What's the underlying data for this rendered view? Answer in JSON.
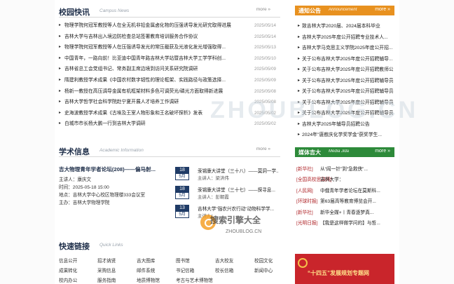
{
  "news": {
    "title": "校园快讯",
    "subtitle": "Campus News",
    "more": "more »",
    "items": [
      {
        "t": "物理学院何冠军教授等人在全无机非铅金属卤化物的压强诱导发光研究取得进展",
        "d": "2025/05/14"
      },
      {
        "t": "吉林大学与吉林出入境边防检查总站签署教育培训服务合作协议",
        "d": "2025/05/14"
      },
      {
        "t": "物理学院何冠军教授等人在压强诱导发光的常压截获及光液化发光增强取得...",
        "d": "2025/05/13"
      },
      {
        "t": "中国青年，一路向前！比亚迪中国青年路吉林大学站暨吉林大学工学学科创...",
        "d": "2025/05/10"
      },
      {
        "t": "吉林省总工会党组书记、常务副主席边境到访问关系研究院调研",
        "d": "2025/05/09"
      },
      {
        "t": "隋建利教授学术成果《中国农村数字韧性的理论框架、实践路径与政策选择...",
        "d": "2025/05/09"
      },
      {
        "t": "杨新一教授在高压调导金属有机框架材料多色可调荧光/磷光方面取得新进展",
        "d": "2025/05/08"
      },
      {
        "t": "吉林大学哲学社会科学院赴宁夏开展人才培养工作调研",
        "d": "2025/05/08"
      },
      {
        "t": "史海波教授学术成果《古埃及王室人物形象和王名破坏探析》发表",
        "d": "2025/05/02"
      },
      {
        "t": "白城市市长杨大鹏一行到吉林大学调研",
        "d": "2025/05/02"
      }
    ]
  },
  "notice": {
    "title": "通知公告",
    "subtitle": "Announcement",
    "more": "more »",
    "items": [
      "致吉林大学2020届、2024届本科毕业",
      "吉林大学2025年度公开招聘专业技术人...",
      "吉林大学马克思主义学院2025年度公开招...",
      "关于公布吉林大学2025年度公开招聘辅导...",
      "关于公布吉林大学2025年度公开招聘教师公告（...",
      "关于公布吉林大学2025年度公开招聘辅导员招聘进...",
      "关于公布吉林大学2025年度公开招聘辅导员招聘进...",
      "关于公布吉林大学2025年度公开招聘辅导员招聘进...",
      "关于公布吉林大学2025年度公开招聘辅导员招聘进...",
      "吉林大学2025年辅导员招聘公告",
      "2024年\"唐敖庆化学奖学金\"获奖学生..."
    ]
  },
  "academic": {
    "title": "学术信息",
    "subtitle": "Academic Information",
    "more": "more »",
    "feature": {
      "title": "吉大物理青年学者论坛(208)——偏马射...",
      "speaker": "主讲人：康庆文",
      "time": "时间：2025-05-18 15:00",
      "place": "地点：吉林大学中心校区物理楼333会议室",
      "host": "主办：吉林大学物理学院"
    },
    "items": [
      {
        "day": "18",
        "mon": "5月",
        "t": "汞锡康大讲堂（三十八）——莫洞一学...",
        "s": "主讲人：梁洪伟"
      },
      {
        "day": "18",
        "mon": "5月",
        "t": "汞锡康大讲堂（三十七）——探寻息...",
        "s": "主讲人：彭朝霞"
      },
      {
        "day": "13",
        "mon": "5月",
        "t": "吉林大学\"强农兴农行动\"动物科学学...",
        "s": "主讲人：..."
      }
    ]
  },
  "media": {
    "title": "媒体吉大",
    "subtitle": "Media Jlda",
    "more": "more »",
    "items": [
      {
        "src": "[新华社]",
        "t": "从“阎一针”到“急救侠”..."
      },
      {
        "src": "[全国高校思政网]",
        "t": "吉林大学："
      },
      {
        "src": "[人民网]",
        "t": "中俄青年学者论坛在莫斯科..."
      },
      {
        "src": "[环球时报]",
        "t": "第63届高等教育博览会开..."
      },
      {
        "src": "[新华社]",
        "t": "新华全媒+丨青春逐梦真..."
      },
      {
        "src": "[光明日报]",
        "t": "【我是这样做学问的】与哲..."
      }
    ]
  },
  "links": {
    "title": "快速链接",
    "subtitle": "Quick Links",
    "items": [
      [
        "信息公开",
        "招才纳贤",
        "吉大图库",
        "图书馆",
        "吉大校友",
        "校园文化"
      ],
      [
        "成果转化",
        "采购信息",
        "邮件系统",
        "书记信箱",
        "校长信箱",
        "新闻中心"
      ],
      [
        "校内办公",
        "服务指南",
        "地质博物馆",
        "考古与艺术博物馆",
        "",
        ""
      ]
    ]
  },
  "banner": {
    "text": "“十四五”发展规划专题网"
  },
  "watermark": {
    "big": "ZHOUBLOG.CN",
    "logo_text": "搜索引擎大全",
    "logo_sub": "ZHOUBLOG.CN"
  },
  "colors": {
    "notice_head": "#e8911f",
    "media_head": "#2d8a3a",
    "nav_blue": "#1f3b66",
    "source_red": "#b0282c"
  }
}
